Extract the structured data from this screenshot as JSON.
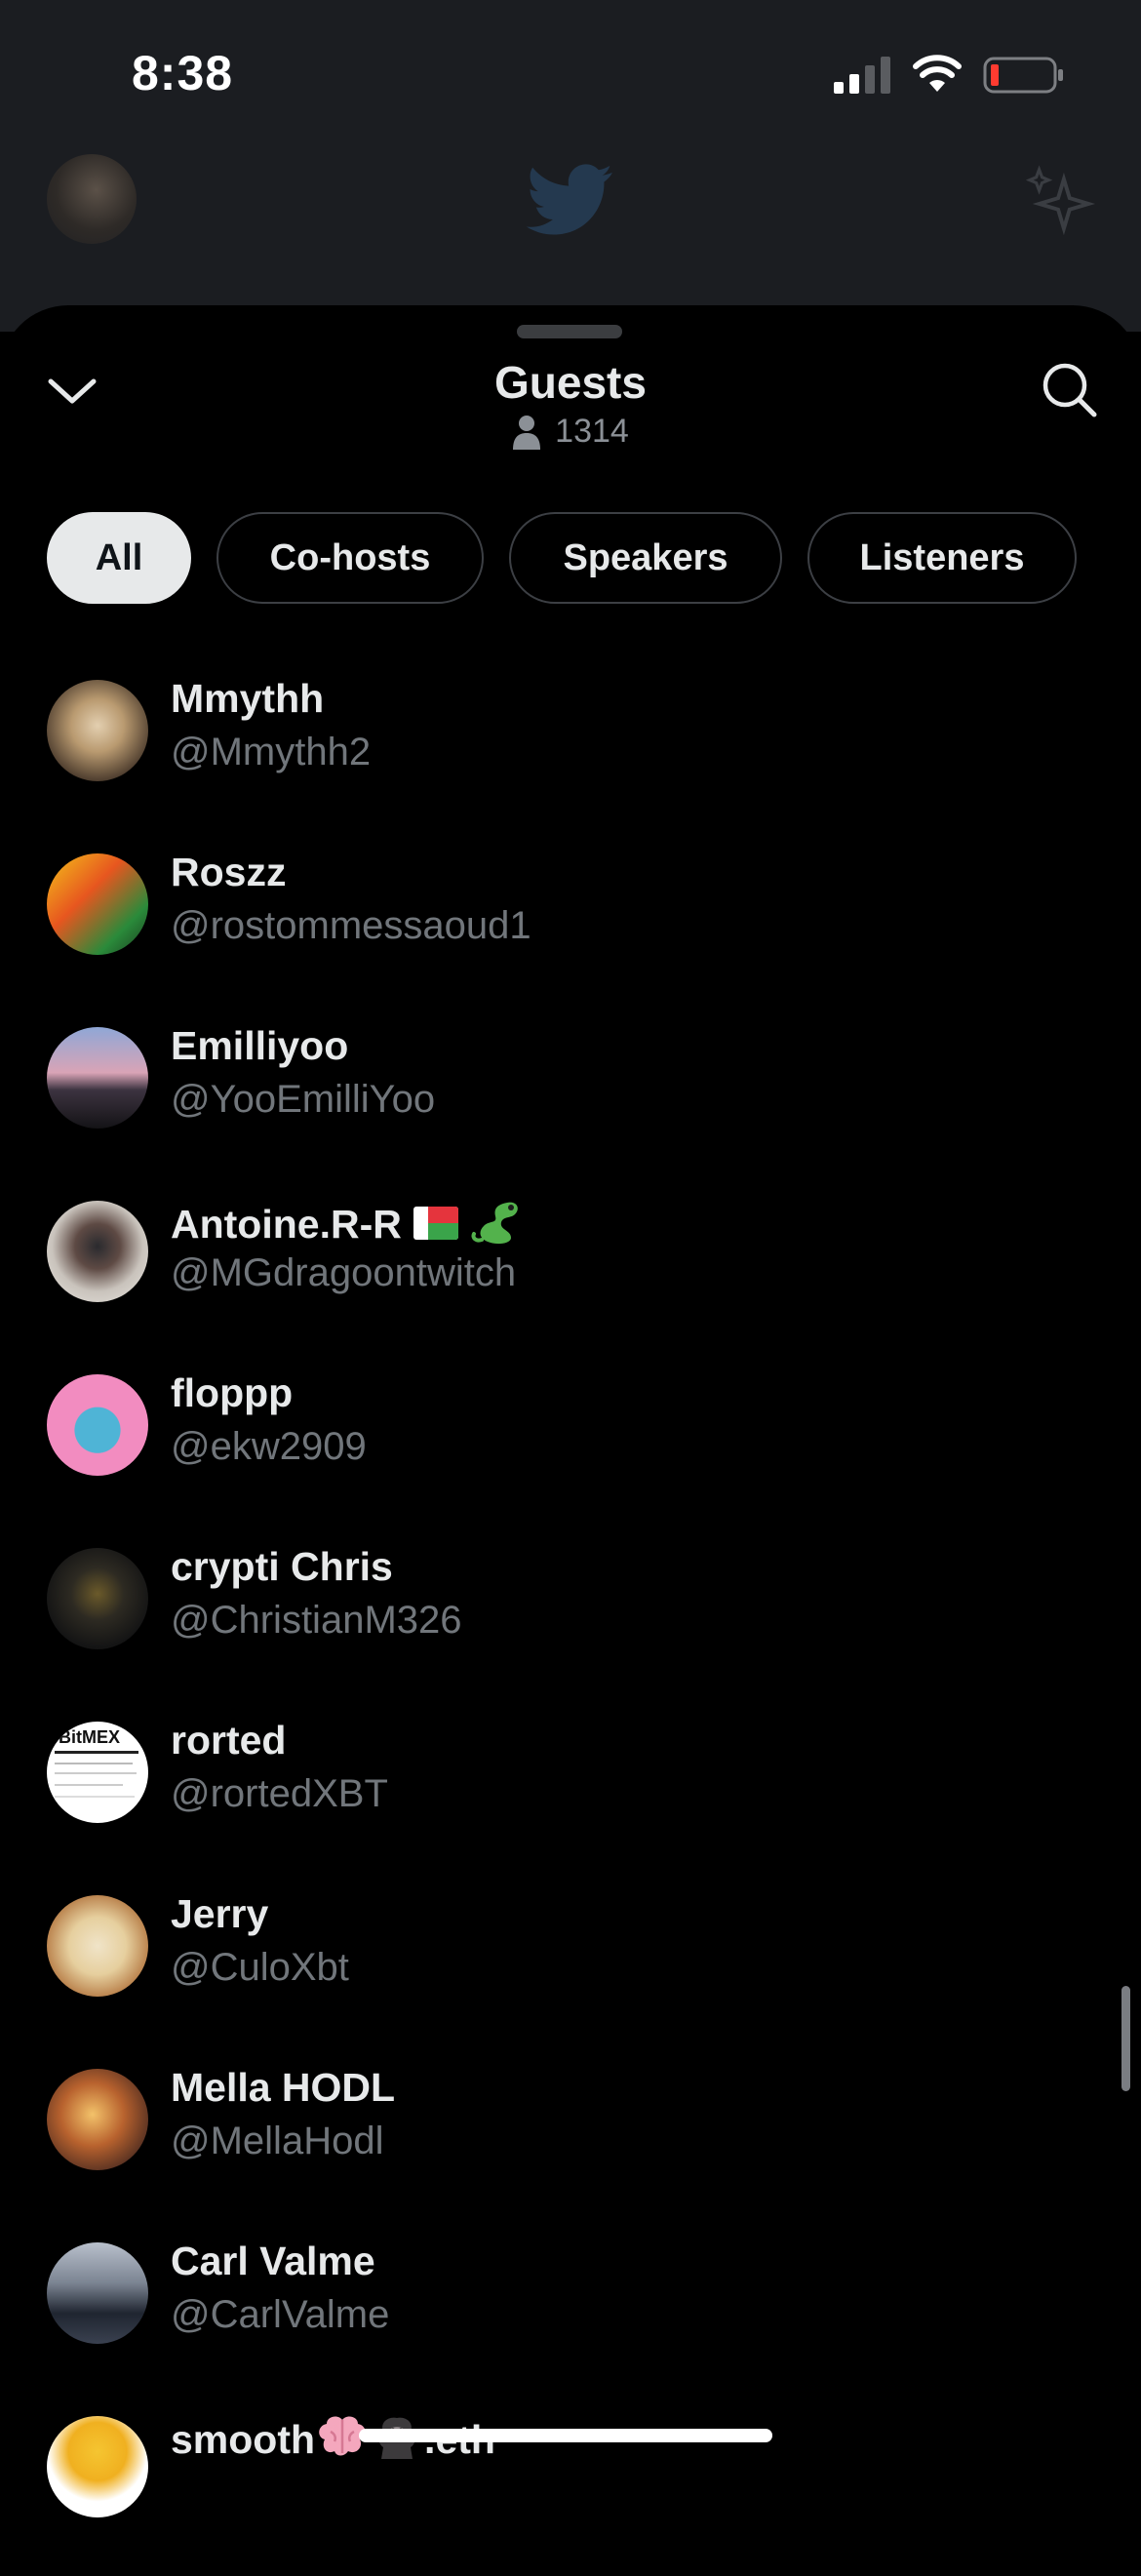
{
  "status_bar": {
    "time": "8:38",
    "signal_icon": "cellular-signal-icon",
    "wifi_icon": "wifi-icon",
    "battery_icon": "battery-low-icon",
    "battery_color": "#ff3b30"
  },
  "background_app": {
    "bird_icon": "twitter-bird-icon",
    "sparkle_icon": "sparkle-icon"
  },
  "sheet": {
    "title": "Guests",
    "count": "1314",
    "collapse_icon": "chevron-down-icon",
    "search_icon": "search-icon",
    "person_icon": "person-icon"
  },
  "tabs": [
    {
      "label": "All",
      "active": true
    },
    {
      "label": "Co-hosts",
      "active": false
    },
    {
      "label": "Speakers",
      "active": false
    },
    {
      "label": "Listeners",
      "active": false
    }
  ],
  "guests": [
    {
      "name": "Mmythh",
      "handle": "@Mmythh2"
    },
    {
      "name": "Roszz",
      "handle": "@rostommessaoud1"
    },
    {
      "name": "Emilliyoo",
      "handle": "@YooEmilliYoo"
    },
    {
      "name": "Antoine.R-R",
      "handle": "@MGdragoontwitch"
    },
    {
      "name": "floppp",
      "handle": "@ekw2909"
    },
    {
      "name": "crypti Chris",
      "handle": "@ChristianM326"
    },
    {
      "name": "rorted",
      "handle": "@rortedXBT"
    },
    {
      "name": "Jerry",
      "handle": "@CuloXbt"
    },
    {
      "name": "Mella HODL",
      "handle": "@MellaHodl"
    },
    {
      "name": "Carl Valme",
      "handle": "@CarlValme"
    },
    {
      "name": "smooth",
      "name_suffix": ".eth",
      "handle": ""
    }
  ],
  "avatar_labels": {
    "rorted": "BitMEX"
  },
  "colors": {
    "background": "#000000",
    "primary_text": "#e7e9ea",
    "secondary_text": "#71767b",
    "tab_border": "#3c3f44"
  }
}
